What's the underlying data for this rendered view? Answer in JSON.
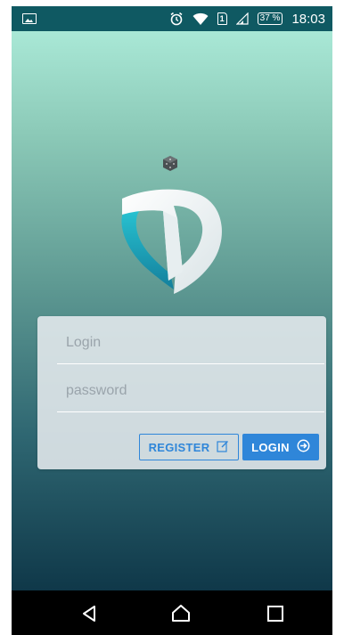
{
  "status_bar": {
    "battery": "37 %",
    "time": "18:03",
    "sim_label": "1",
    "icons": [
      "image-icon",
      "alarm-icon",
      "wifi-icon",
      "sim-icon",
      "signal-icon",
      "battery-icon"
    ]
  },
  "colors": {
    "status_bar": "#0f5962",
    "gradient_top": "#a9e8d6",
    "gradient_bottom": "#0f3849",
    "accent": "#2f86d9",
    "logo_teal": "#20b6c6"
  },
  "form": {
    "login_placeholder": "Login",
    "login_value": "",
    "password_placeholder": "password",
    "password_value": "",
    "register_label": "REGISTER",
    "login_label": "LOGIN"
  },
  "nav": {
    "icons": [
      "back-icon",
      "home-icon",
      "recents-icon"
    ]
  }
}
